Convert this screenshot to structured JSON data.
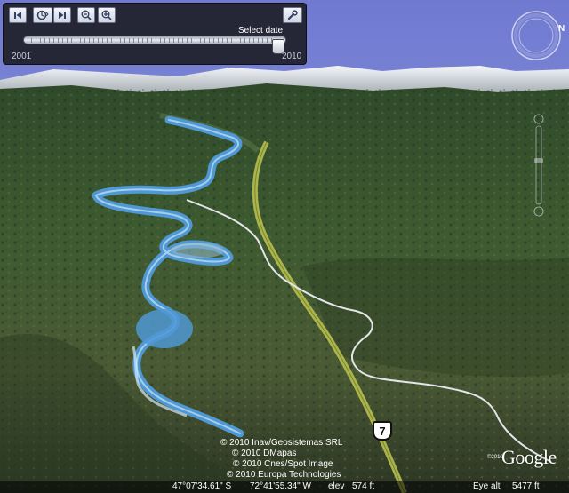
{
  "time_slider": {
    "select_date_label": "Select date",
    "year_start": "2001",
    "year_end": "2010",
    "buttons": {
      "back_icon": "skip-back-icon",
      "clock_icon": "clock-settings-icon",
      "forward_icon": "skip-forward-icon",
      "zoom_out_icon": "zoom-out-icon",
      "zoom_in_icon": "zoom-in-icon",
      "settings_icon": "wrench-icon"
    },
    "selected_position": 0.97
  },
  "navigation": {
    "north_label": "N",
    "compass_icon": "compass-ring-icon",
    "zoom_icon": "zoom-slider-icon"
  },
  "map": {
    "route_label": "7",
    "attribution": [
      "© 2010 Inav/Geosistemas SRL",
      "© 2010 DMapas",
      "© 2010 Cnes/Spot Image",
      "© 2010 Europa Technologies"
    ],
    "copyright_year": "©2010",
    "logo": "Google"
  },
  "status_bar": {
    "latitude": "47°07'34.61\" S",
    "longitude": "72°41'55.34\" W",
    "elev_label": "elev",
    "elev_value": "574 ft",
    "eye_alt_label": "Eye alt",
    "eye_alt_value": "5477 ft"
  },
  "colors": {
    "sky": "#7d86d6",
    "river": "#4f98d4",
    "road_highlight": "#b8c050"
  }
}
